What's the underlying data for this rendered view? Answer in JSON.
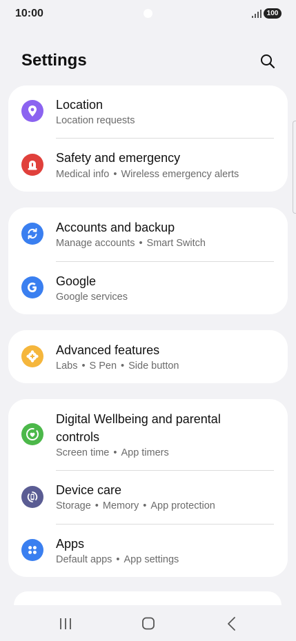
{
  "status": {
    "time": "10:00",
    "battery": "100"
  },
  "header": {
    "title": "Settings"
  },
  "groups": [
    [
      {
        "id": "location",
        "title": "Location",
        "subtitle": [
          "Location requests"
        ],
        "icon": "location-pin-icon",
        "color": "#8b63f0"
      },
      {
        "id": "safety",
        "title": "Safety and emergency",
        "subtitle": [
          "Medical info",
          "Wireless emergency alerts"
        ],
        "icon": "siren-icon",
        "color": "#e0403b"
      }
    ],
    [
      {
        "id": "accounts",
        "title": "Accounts and backup",
        "subtitle": [
          "Manage accounts",
          "Smart Switch"
        ],
        "icon": "sync-icon",
        "color": "#3a7ff0"
      },
      {
        "id": "google",
        "title": "Google",
        "subtitle": [
          "Google services"
        ],
        "icon": "google-g-icon",
        "color": "#3a7ff0"
      }
    ],
    [
      {
        "id": "advanced",
        "title": "Advanced features",
        "subtitle": [
          "Labs",
          "S Pen",
          "Side button"
        ],
        "icon": "gear-plus-icon",
        "color": "#f5b63c"
      }
    ],
    [
      {
        "id": "wellbeing",
        "title": "Digital Wellbeing and parental controls",
        "subtitle": [
          "Screen time",
          "App timers"
        ],
        "icon": "wellbeing-heart-icon",
        "color": "#4cb84a"
      },
      {
        "id": "devicecare",
        "title": "Device care",
        "subtitle": [
          "Storage",
          "Memory",
          "App protection"
        ],
        "icon": "device-care-icon",
        "color": "#5a5c93"
      },
      {
        "id": "apps",
        "title": "Apps",
        "subtitle": [
          "Default apps",
          "App settings"
        ],
        "icon": "apps-grid-icon",
        "color": "#3a7ff0"
      }
    ]
  ]
}
